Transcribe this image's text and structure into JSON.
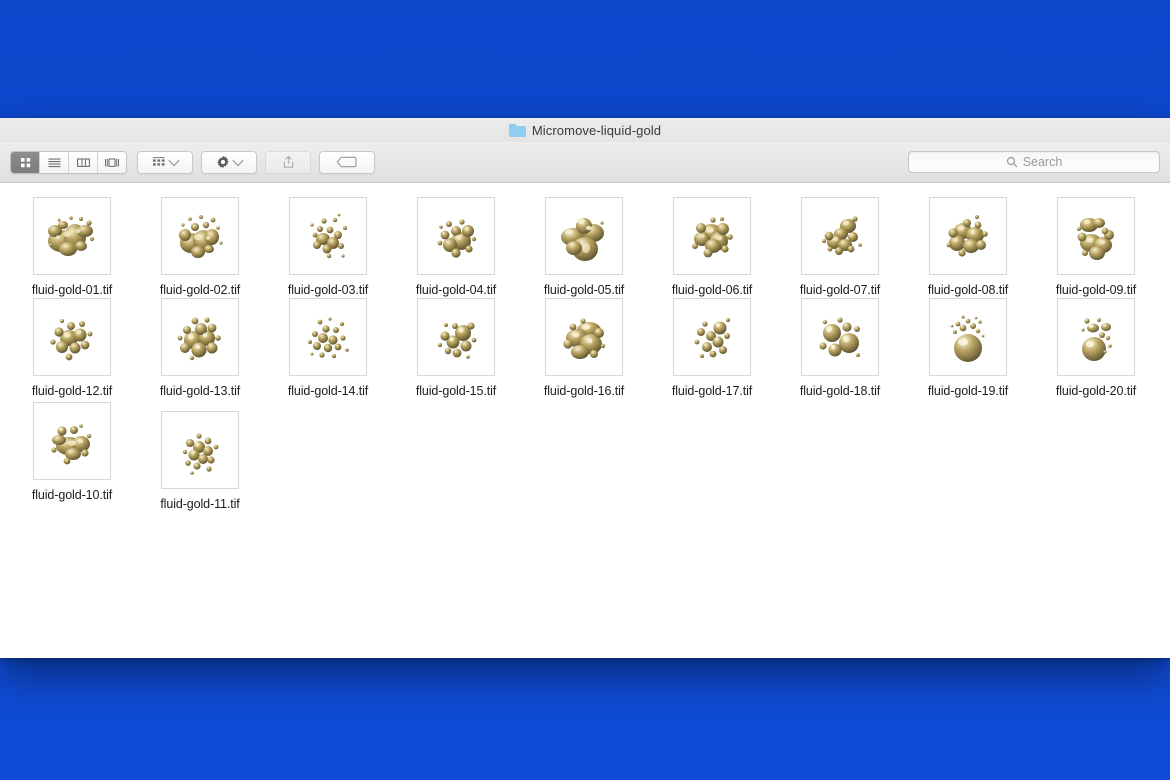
{
  "desktop": {
    "background_color": "#0e4ad0"
  },
  "window": {
    "title": "Micromove-liquid-gold",
    "folder_icon": "folder-icon"
  },
  "toolbar": {
    "view_modes": [
      {
        "name": "icon-view",
        "icon": "grid-icon",
        "active": true
      },
      {
        "name": "list-view",
        "icon": "list-icon",
        "active": false
      },
      {
        "name": "column-view",
        "icon": "columns-icon",
        "active": false
      },
      {
        "name": "gallery-view",
        "icon": "gallery-icon",
        "active": false
      }
    ],
    "buttons": [
      {
        "name": "group-by-button",
        "icon": "grid-small-icon",
        "has_chevron": true,
        "disabled": false
      },
      {
        "name": "action-menu-button",
        "icon": "gear-icon",
        "has_chevron": true,
        "disabled": false
      },
      {
        "name": "share-button",
        "icon": "share-icon",
        "has_chevron": false,
        "disabled": true
      },
      {
        "name": "tag-button",
        "icon": "tag-icon",
        "has_chevron": false,
        "disabled": false
      }
    ]
  },
  "search": {
    "icon": "search-icon",
    "placeholder": "Search",
    "value": ""
  },
  "files": {
    "rows": [
      {
        "items": [
          {
            "label": "fluid-gold-01.tif",
            "art": "splatter-wide"
          },
          {
            "label": "fluid-gold-02.tif",
            "art": "cluster-spray"
          },
          {
            "label": "fluid-gold-03.tif",
            "art": "scatter-small"
          },
          {
            "label": "fluid-gold-04.tif",
            "art": "loose-blobs"
          },
          {
            "label": "fluid-gold-05.tif",
            "art": "big-lobes"
          },
          {
            "label": "fluid-gold-06.tif",
            "art": "dense-knot"
          },
          {
            "label": "fluid-gold-07.tif",
            "art": "diagonal-chain"
          },
          {
            "label": "fluid-gold-08.tif",
            "art": "arched-cluster"
          },
          {
            "label": "fluid-gold-09.tif",
            "art": "twin-mass"
          }
        ]
      },
      {
        "items": [
          {
            "label": "fluid-gold-12.tif",
            "art": "scatter-round"
          },
          {
            "label": "fluid-gold-13.tif",
            "art": "bubble-pile"
          },
          {
            "label": "fluid-gold-14.tif",
            "art": "fine-spray"
          },
          {
            "label": "fluid-gold-15.tif",
            "art": "sparse-orbs"
          },
          {
            "label": "fluid-gold-16.tif",
            "art": "merged-mass"
          },
          {
            "label": "fluid-gold-17.tif",
            "art": "drip-trail"
          },
          {
            "label": "fluid-gold-18.tif",
            "art": "three-spheres"
          },
          {
            "label": "fluid-gold-19.tif",
            "art": "sphere-burst"
          },
          {
            "label": "fluid-gold-20.tif",
            "art": "sphere-splash"
          }
        ]
      },
      {
        "items": [
          {
            "label": "fluid-gold-10.tif",
            "art": "flat-blob-cluster"
          },
          {
            "label": "fluid-gold-11.tif",
            "art": "vertical-scatter"
          }
        ]
      }
    ]
  },
  "colors": {
    "desktop_blue": "#0e4ad0",
    "gold_light": "#f2e7b8",
    "gold_mid": "#b9a25c",
    "gold_dark": "#6e6236",
    "window_chrome": "#e8e8e8"
  }
}
